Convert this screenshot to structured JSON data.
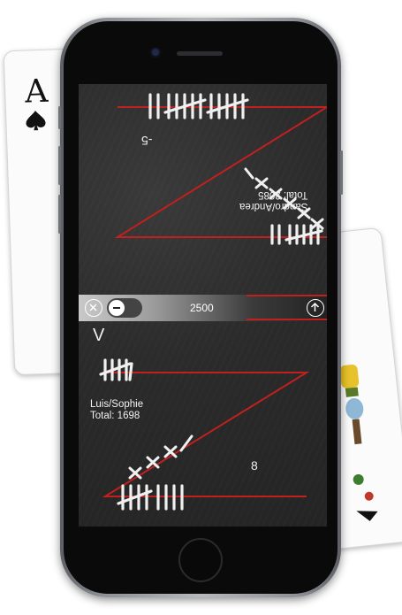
{
  "cards": {
    "left": {
      "rank": "A",
      "suit": "spade-icon"
    },
    "right": {
      "rank": "",
      "suit": "card-art-icon"
    }
  },
  "screen": {
    "accent_color": "#c0201e",
    "chalk_color": "#f0f0f0",
    "top_team": {
      "name": "Sandro/Andrea",
      "total_label": "Total: 2085"
    },
    "top_marker_number": "-5",
    "bottom_team": {
      "name": "Luis/Sophie",
      "total_label": "Total: 1698"
    },
    "bottom_marker_number": "8",
    "side_marker": "V",
    "toolbar": {
      "value": "2500",
      "clear_icon": "close-icon",
      "toggle_icon": "minus-icon",
      "up_icon": "arrow-up-icon"
    }
  }
}
